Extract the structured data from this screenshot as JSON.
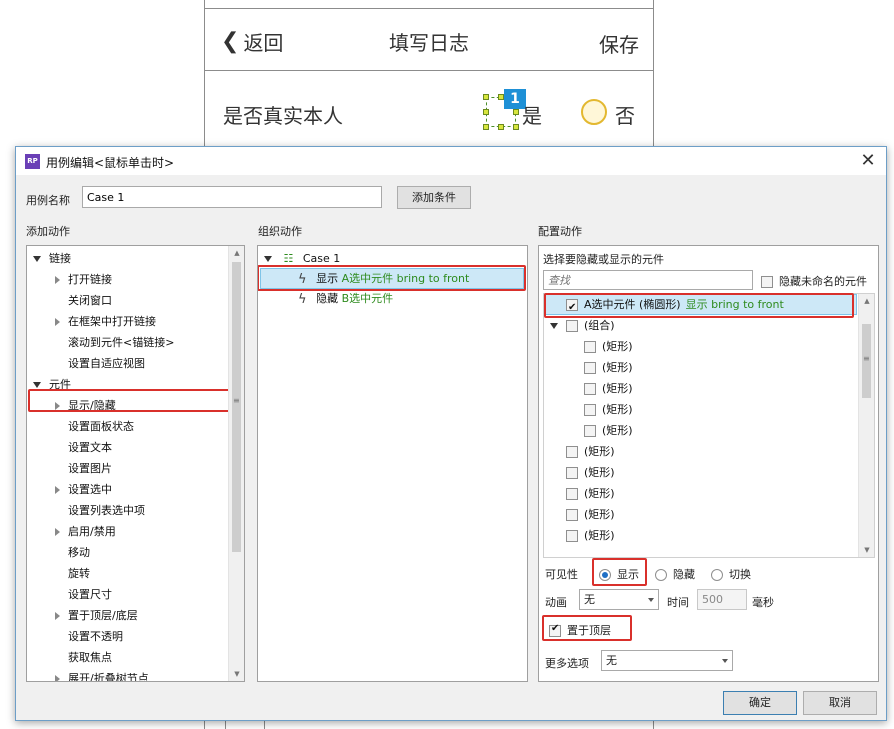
{
  "phone": {
    "back_label": "返回",
    "title": "填写日志",
    "save_label": "保存",
    "row_label": "是否真实本人",
    "badge": "1",
    "yes_label": "是",
    "no_label": "否"
  },
  "dialog": {
    "title": "用例编辑<鼠标单击时>",
    "close": "✕",
    "case_name_label": "用例名称",
    "case_name_value": "Case 1",
    "add_condition": "添加条件",
    "ok": "确定",
    "cancel": "取消"
  },
  "add_action": {
    "header": "添加动作",
    "items": [
      {
        "label": "链接",
        "indent": 0,
        "expander": "down"
      },
      {
        "label": "打开链接",
        "indent": 1,
        "expander": "right"
      },
      {
        "label": "关闭窗口",
        "indent": 1,
        "expander": ""
      },
      {
        "label": "在框架中打开链接",
        "indent": 1,
        "expander": "right"
      },
      {
        "label": "滚动到元件<锚链接>",
        "indent": 1,
        "expander": ""
      },
      {
        "label": "设置自适应视图",
        "indent": 1,
        "expander": ""
      },
      {
        "label": "元件",
        "indent": 0,
        "expander": "down"
      },
      {
        "label": "显示/隐藏",
        "indent": 1,
        "expander": "right"
      },
      {
        "label": "设置面板状态",
        "indent": 1,
        "expander": ""
      },
      {
        "label": "设置文本",
        "indent": 1,
        "expander": ""
      },
      {
        "label": "设置图片",
        "indent": 1,
        "expander": ""
      },
      {
        "label": "设置选中",
        "indent": 1,
        "expander": "right"
      },
      {
        "label": "设置列表选中项",
        "indent": 1,
        "expander": ""
      },
      {
        "label": "启用/禁用",
        "indent": 1,
        "expander": "right"
      },
      {
        "label": "移动",
        "indent": 1,
        "expander": ""
      },
      {
        "label": "旋转",
        "indent": 1,
        "expander": ""
      },
      {
        "label": "设置尺寸",
        "indent": 1,
        "expander": ""
      },
      {
        "label": "置于顶层/底层",
        "indent": 1,
        "expander": "right"
      },
      {
        "label": "设置不透明",
        "indent": 1,
        "expander": ""
      },
      {
        "label": "获取焦点",
        "indent": 1,
        "expander": ""
      },
      {
        "label": "展开/折叠树节点",
        "indent": 1,
        "expander": "right"
      }
    ]
  },
  "organize_action": {
    "header": "组织动作",
    "case_label": "Case 1",
    "actions": [
      {
        "verb": "显示",
        "target": "A选中元件 bring to front"
      },
      {
        "verb": "隐藏",
        "target": "B选中元件"
      }
    ]
  },
  "configure_action": {
    "header": "配置动作",
    "select_label": "选择要隐藏或显示的元件",
    "search_placeholder": "查找",
    "hide_unnamed": "隐藏未命名的元件",
    "widgets": [
      {
        "label": "A选中元件 (椭圆形)",
        "extra": "显示 bring to front",
        "checked": true,
        "indent": 0,
        "expander": ""
      },
      {
        "label": "(组合)",
        "extra": "",
        "checked": false,
        "indent": 0,
        "expander": "down"
      },
      {
        "label": "(矩形)",
        "extra": "",
        "checked": false,
        "indent": 1,
        "expander": ""
      },
      {
        "label": "(矩形)",
        "extra": "",
        "checked": false,
        "indent": 1,
        "expander": ""
      },
      {
        "label": "(矩形)",
        "extra": "",
        "checked": false,
        "indent": 1,
        "expander": ""
      },
      {
        "label": "(矩形)",
        "extra": "",
        "checked": false,
        "indent": 1,
        "expander": ""
      },
      {
        "label": "(矩形)",
        "extra": "",
        "checked": false,
        "indent": 1,
        "expander": ""
      },
      {
        "label": "(矩形)",
        "extra": "",
        "checked": false,
        "indent": 0,
        "expander": ""
      },
      {
        "label": "(矩形)",
        "extra": "",
        "checked": false,
        "indent": 0,
        "expander": ""
      },
      {
        "label": "(矩形)",
        "extra": "",
        "checked": false,
        "indent": 0,
        "expander": ""
      },
      {
        "label": "(矩形)",
        "extra": "",
        "checked": false,
        "indent": 0,
        "expander": ""
      },
      {
        "label": "(矩形)",
        "extra": "",
        "checked": false,
        "indent": 0,
        "expander": ""
      }
    ],
    "visibility_label": "可见性",
    "visibility_options": [
      "显示",
      "隐藏",
      "切换"
    ],
    "visibility_selected": "显示",
    "animation_label": "动画",
    "animation_value": "无",
    "time_label": "时间",
    "time_value": "500",
    "time_unit": "毫秒",
    "bring_to_front_label": "置于顶层",
    "bring_to_front_checked": true,
    "more_options_label": "更多选项",
    "more_options_value": "无"
  },
  "colors": {
    "highlight_red": "#d9302b",
    "selected_row": "#cde8f7",
    "action_target_green": "#2e8b1e",
    "badge_blue": "#1e90d6",
    "radio_no_yellow": "#e3b830"
  }
}
